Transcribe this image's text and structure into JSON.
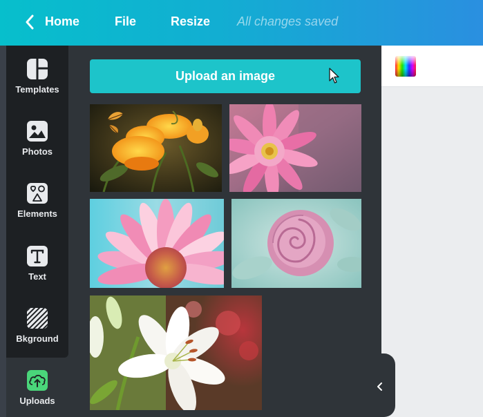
{
  "topbar": {
    "back_icon": "chevron-left-icon",
    "home_label": "Home",
    "file_label": "File",
    "resize_label": "Resize",
    "save_status": "All changes saved",
    "gradient_start": "#07bfcc",
    "gradient_end": "#2a8fe0"
  },
  "sidebar": {
    "items": [
      {
        "label": "Templates",
        "icon": "templates-icon"
      },
      {
        "label": "Photos",
        "icon": "photos-icon"
      },
      {
        "label": "Elements",
        "icon": "elements-icon"
      },
      {
        "label": "Text",
        "icon": "text-icon"
      },
      {
        "label": "Bkground",
        "icon": "background-icon"
      },
      {
        "label": "Uploads",
        "icon": "uploads-icon",
        "active": true
      }
    ],
    "active_color": "#4ad57a"
  },
  "uploads": {
    "button_label": "Upload an image",
    "button_color": "#1dc4ca",
    "images": [
      {
        "subject": "orange flowers with butterfly"
      },
      {
        "subject": "pink dahlia"
      },
      {
        "subject": "pink daisy"
      },
      {
        "subject": "pink rose"
      },
      {
        "subject": "white lily"
      }
    ]
  },
  "canvas": {
    "color_picker_icon": "rainbow-color-swatch",
    "collapse_icon": "chevron-left-icon"
  }
}
